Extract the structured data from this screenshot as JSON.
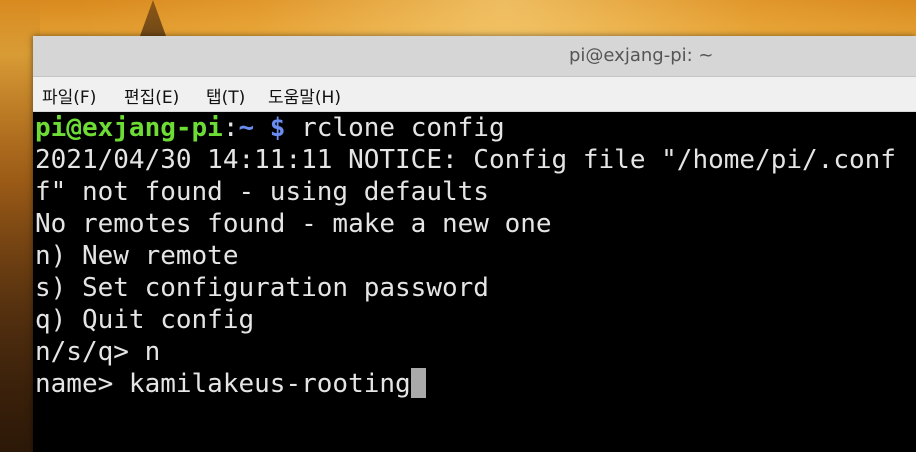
{
  "window": {
    "title": "pi@exjang-pi: ~"
  },
  "menu": {
    "items": [
      "파일(F)",
      "편집(E)",
      "탭(T)",
      "도움말(H)"
    ]
  },
  "terminal": {
    "prompt_user": "pi@exjang-pi",
    "prompt_colon": ":",
    "prompt_path": "~",
    "prompt_dollar": " $",
    "command": " rclone config",
    "lines": [
      "2021/04/30 14:11:11 NOTICE: Config file \"/home/pi/.conf",
      "f\" not found - using defaults",
      "No remotes found - make a new one",
      "n) New remote",
      "s) Set configuration password",
      "q) Quit config",
      "n/s/q> n",
      "name> kamilakeus-rooting"
    ]
  },
  "colors": {
    "prompt_user": "#6ddd35",
    "prompt_path": "#6b8cf0",
    "terminal_bg": "#000000",
    "terminal_fg": "#e5e5e5"
  }
}
